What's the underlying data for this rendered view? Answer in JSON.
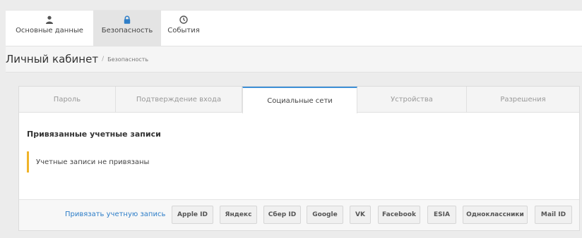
{
  "nav": {
    "items": [
      {
        "label": "Основные данные",
        "icon": "user-icon",
        "active": false
      },
      {
        "label": "Безопасность",
        "icon": "lock-icon",
        "active": true
      },
      {
        "label": "События",
        "icon": "clock-icon",
        "active": false
      }
    ]
  },
  "header": {
    "title": "Личный кабинет",
    "separator": "/",
    "breadcrumb": "Безопасность"
  },
  "tabs": [
    {
      "label": "Пароль",
      "active": false
    },
    {
      "label": "Подтверждение входа",
      "active": false
    },
    {
      "label": "Социальные сети",
      "active": true
    },
    {
      "label": "Устройства",
      "active": false
    },
    {
      "label": "Разрешения",
      "active": false
    }
  ],
  "content": {
    "section_title": "Привязанные учетные записи",
    "alert_text": "Учетные записи не привязаны"
  },
  "footer": {
    "link_label": "Привязать учетную запись",
    "buttons": [
      "Apple ID",
      "Яндекс",
      "Сбер ID",
      "Google",
      "VK",
      "Facebook",
      "ESIA",
      "Одноклассники",
      "Mail ID"
    ]
  },
  "colors": {
    "accent": "#3d8fd6",
    "link": "#2e7ec8",
    "warning": "#f0b429"
  }
}
